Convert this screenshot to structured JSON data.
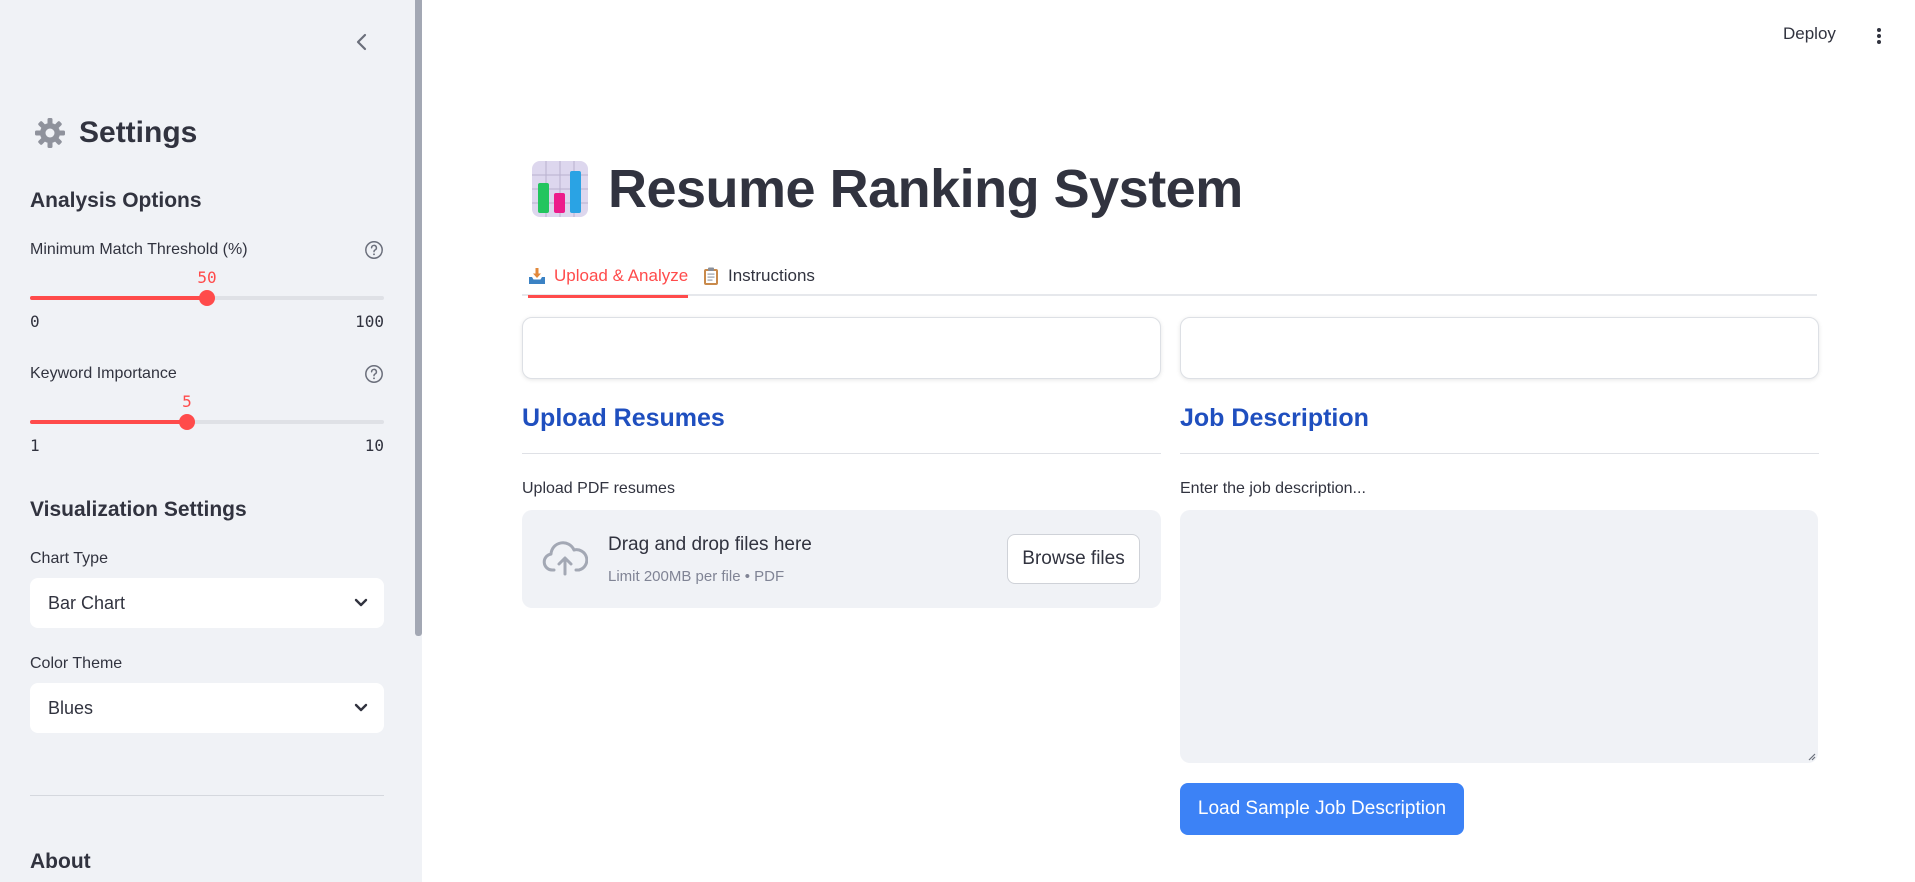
{
  "sidebar": {
    "title": "Settings",
    "title_icon": "gear-icon",
    "analysis_heading": "Analysis Options",
    "threshold": {
      "label": "Minimum Match Threshold (%)",
      "value": "50",
      "min": "0",
      "max": "100",
      "fraction": 0.5
    },
    "keyword": {
      "label": "Keyword Importance",
      "value": "5",
      "min": "1",
      "max": "10",
      "fraction": 0.4444
    },
    "viz_heading": "Visualization Settings",
    "chart_type": {
      "label": "Chart Type",
      "value": "Bar Chart"
    },
    "color_theme": {
      "label": "Color Theme",
      "value": "Blues"
    },
    "about_heading": "About"
  },
  "header": {
    "deploy_label": "Deploy"
  },
  "main": {
    "title": "Resume Ranking System",
    "title_icon": "bar-chart-icon",
    "tabs": [
      {
        "label": "Upload & Analyze",
        "icon": "inbox-tray-icon",
        "active": true
      },
      {
        "label": "Instructions",
        "icon": "clipboard-icon",
        "active": false
      }
    ],
    "upload": {
      "heading": "Upload Resumes",
      "field_label": "Upload PDF resumes",
      "drop_text": "Drag and drop files here",
      "limit_text": "Limit 200MB per file • PDF",
      "browse_label": "Browse files"
    },
    "job": {
      "heading": "Job Description",
      "field_label": "Enter the job description...",
      "value": "",
      "sample_button_label": "Load Sample Job Description"
    }
  },
  "colors": {
    "accent": "#ff4b4b",
    "primary": "#3c82f6",
    "heading_blue": "#1f4fbf",
    "sidebar_bg": "#f0f2f6"
  }
}
